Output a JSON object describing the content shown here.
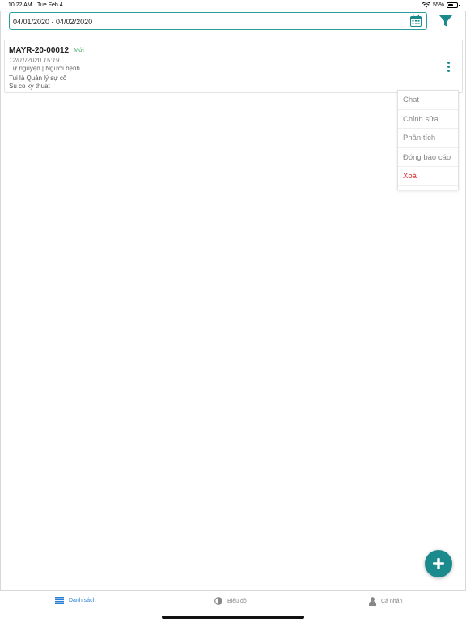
{
  "status_bar": {
    "time": "10:22 AM",
    "date": "Tue Feb 4",
    "battery": "55%",
    "battery_level": 0.55
  },
  "filter": {
    "date_range": "04/01/2020 - 04/02/2020"
  },
  "report": {
    "code": "MAYR-20-00012",
    "status": "Mới",
    "datetime": "12/01/2020 15:19",
    "type": "Tự nguyện | Người bệnh",
    "description_line1": "Tui là Quản lý sự cố",
    "description_line2": "Su co ky thuat"
  },
  "context_menu": {
    "items": [
      "Chat",
      "Chỉnh sửa",
      "Phân tích",
      "Đóng báo cáo",
      "Xoá"
    ]
  },
  "tabs": [
    {
      "label": "Danh sách",
      "icon": "list-icon",
      "active": true
    },
    {
      "label": "Biểu đồ",
      "icon": "chart-icon",
      "active": false
    },
    {
      "label": "Cá nhân",
      "icon": "person-icon",
      "active": false
    }
  ],
  "colors": {
    "accent": "#1a8a8c",
    "active_tab": "#2a7fd4",
    "danger": "#d62626",
    "status_new": "#3aa85a"
  }
}
